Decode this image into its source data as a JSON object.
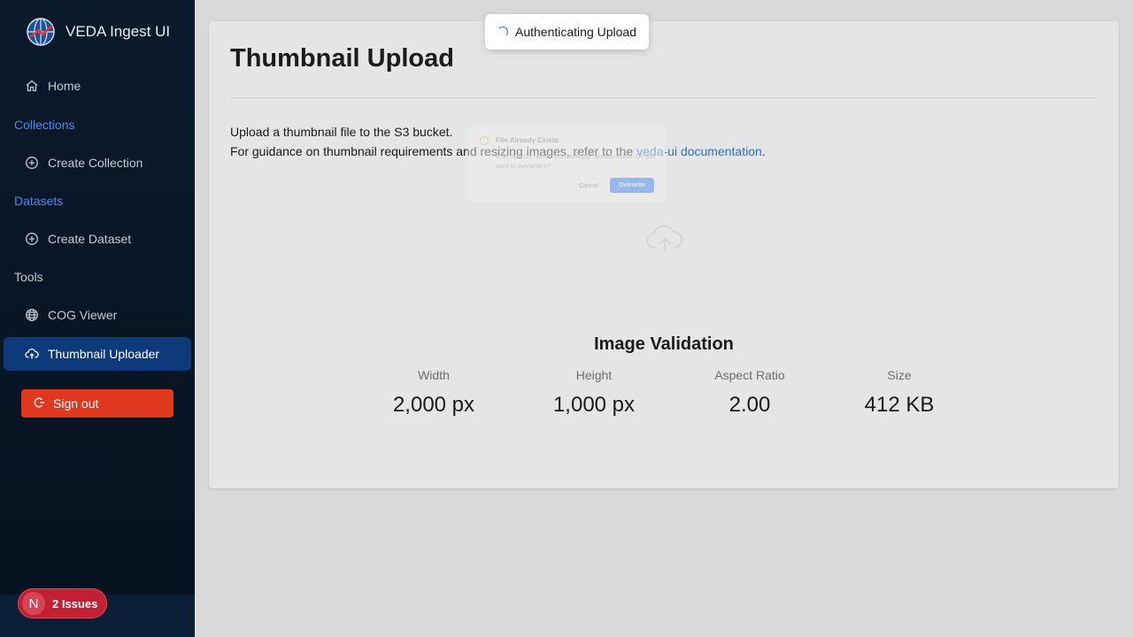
{
  "app": {
    "title": "VEDA Ingest UI"
  },
  "sidebar": {
    "home": "Home",
    "sections": {
      "collections": "Collections",
      "datasets": "Datasets",
      "tools": "Tools"
    },
    "items": {
      "create_collection": "Create Collection",
      "create_dataset": "Create Dataset",
      "cog_viewer": "COG Viewer",
      "thumbnail_uploader": "Thumbnail Uploader"
    },
    "signout": "Sign out",
    "active_item": "Thumbnail Uploader"
  },
  "issues": {
    "letter": "N",
    "label": "2 Issues"
  },
  "toast": {
    "text": "Authenticating Upload"
  },
  "main": {
    "title": "Thumbnail Upload",
    "desc_line1": "Upload a thumbnail file to the S3 bucket.",
    "desc_line2_prefix": "For guidance on thumbnail requirements and resizing images, refer to the ",
    "desc_link": "veda-ui documentation",
    "desc_line2_suffix": "."
  },
  "modal": {
    "title": "File Already Exists",
    "message": "A file with the name \"thumbnail.jpg\" already exists. Do you want to overwrite it?",
    "cancel": "Cancel",
    "confirm": "Overwrite"
  },
  "validation": {
    "title": "Image Validation",
    "width_label": "Width",
    "width_value": "2,000 px",
    "height_label": "Height",
    "height_value": "1,000 px",
    "aspect_label": "Aspect Ratio",
    "aspect_value": "2.00",
    "size_label": "Size",
    "size_value": "412 KB"
  },
  "colors": {
    "sidebar_bg": "#0b1a2b",
    "active_bg": "#0c3a7a",
    "section_blue": "#3f8cff",
    "signout_red": "#e0381f",
    "link_blue": "#2b6fd6",
    "issues_red": "#c21f34"
  }
}
